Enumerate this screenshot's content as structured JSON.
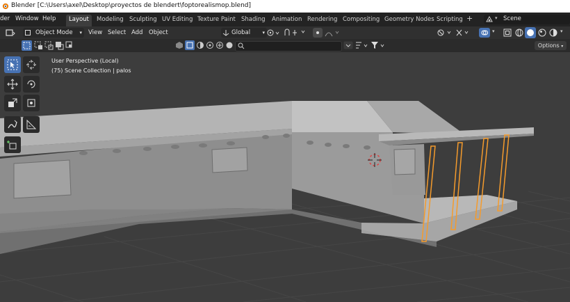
{
  "window": {
    "title": "Blender [C:\\Users\\axel\\Desktop\\proyectos de blendert\\foptorealismop.blend]"
  },
  "menu": [
    "der",
    "Window",
    "Help"
  ],
  "workspaces": [
    "Layout",
    "Modeling",
    "Sculpting",
    "UV Editing",
    "Texture Paint",
    "Shading",
    "Animation",
    "Rendering",
    "Compositing",
    "Geometry Nodes",
    "Scripting"
  ],
  "add_workspace": "+",
  "scene": "Scene",
  "header": {
    "mode": "Object Mode",
    "items": [
      "View",
      "Select",
      "Add",
      "Object"
    ],
    "orientation": "Global"
  },
  "options_label": "Options",
  "viewport": {
    "perspective": "User Perspective (Local)",
    "collection": "(75) Scene Collection | palos"
  },
  "colors": {
    "accent": "#4772b3",
    "selection": "#f59b2c",
    "background": "#3d3d3d"
  }
}
